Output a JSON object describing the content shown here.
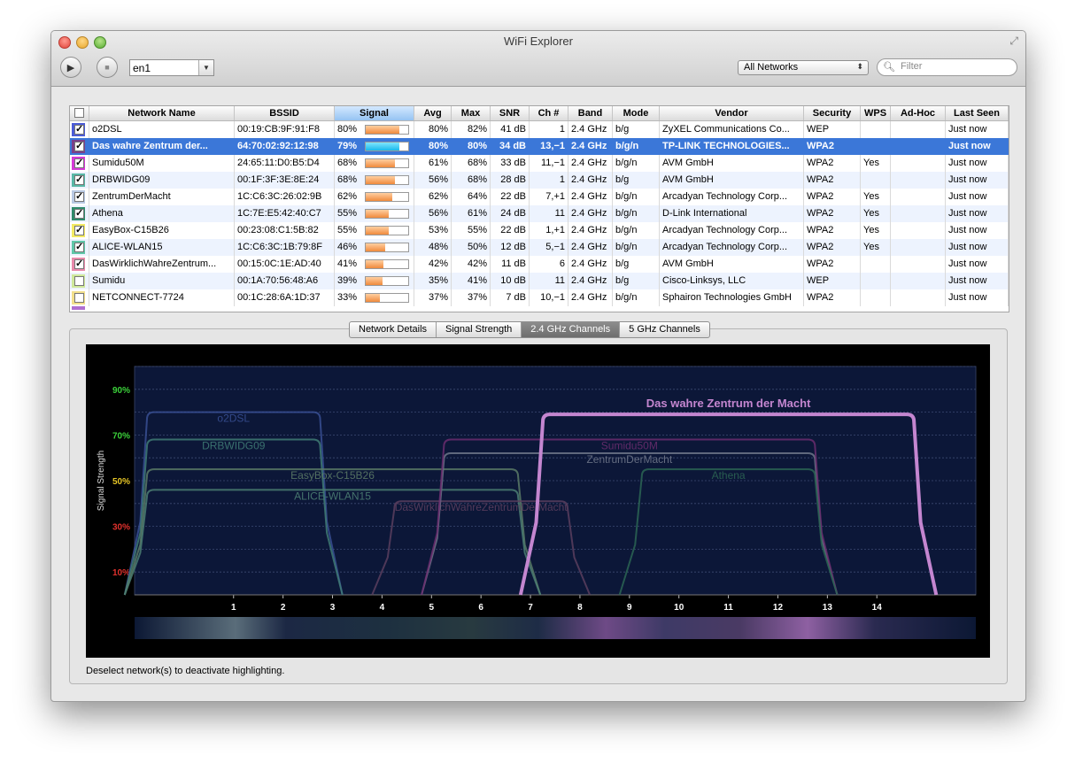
{
  "window": {
    "title": "WiFi Explorer"
  },
  "toolbar": {
    "interface_value": "en1",
    "networks_select": "All Networks",
    "filter_placeholder": "Filter"
  },
  "table": {
    "columns": [
      "Network Name",
      "BSSID",
      "Signal",
      "Avg",
      "Max",
      "SNR",
      "Ch #",
      "Band",
      "Mode",
      "Vendor",
      "Security",
      "WPS",
      "Ad-Hoc",
      "Last Seen"
    ],
    "rows": [
      {
        "name": "o2DSL",
        "bssid": "00:19:CB:9F:91:F8",
        "signal": "80%",
        "signal_value": 80,
        "avg": "80%",
        "max": "82%",
        "snr": "41 dB",
        "ch": "1",
        "band": "2.4 GHz",
        "mode": "b/g",
        "vendor": "ZyXEL Communications Co...",
        "security": "WEP",
        "wps": "",
        "adhoc": "",
        "last_seen": "Just now",
        "color": "#4b5bd6",
        "checked": true
      },
      {
        "name": "Das wahre Zentrum der...",
        "bssid": "64:70:02:92:12:98",
        "signal": "79%",
        "signal_value": 79,
        "avg": "80%",
        "max": "80%",
        "snr": "34 dB",
        "ch": "13,−1",
        "band": "2.4 GHz",
        "mode": "b/g/n",
        "vendor": "TP-LINK TECHNOLOGIES...",
        "security": "WPA2",
        "wps": "",
        "adhoc": "",
        "last_seen": "Just now",
        "color": "#7a3f8a",
        "checked": true
      },
      {
        "name": "Sumidu50M",
        "bssid": "24:65:11:D0:B5:D4",
        "signal": "68%",
        "signal_value": 68,
        "avg": "61%",
        "max": "68%",
        "snr": "33 dB",
        "ch": "11,−1",
        "band": "2.4 GHz",
        "mode": "b/g/n",
        "vendor": "AVM GmbH",
        "security": "WPA2",
        "wps": "Yes",
        "adhoc": "",
        "last_seen": "Just now",
        "color": "#d63ad8",
        "checked": true
      },
      {
        "name": "DRBWIDG09",
        "bssid": "00:1F:3F:3E:8E:24",
        "signal": "68%",
        "signal_value": 68,
        "avg": "56%",
        "max": "68%",
        "snr": "28 dB",
        "ch": "1",
        "band": "2.4 GHz",
        "mode": "b/g",
        "vendor": "AVM GmbH",
        "security": "WPA2",
        "wps": "",
        "adhoc": "",
        "last_seen": "Just now",
        "color": "#58b7a6",
        "checked": true
      },
      {
        "name": "ZentrumDerMacht",
        "bssid": "1C:C6:3C:26:02:9B",
        "signal": "62%",
        "signal_value": 62,
        "avg": "62%",
        "max": "64%",
        "snr": "22 dB",
        "ch": "7,+1",
        "band": "2.4 GHz",
        "mode": "b/g/n",
        "vendor": "Arcadyan Technology Corp...",
        "security": "WPA2",
        "wps": "Yes",
        "adhoc": "",
        "last_seen": "Just now",
        "color": "#b9c9e3",
        "checked": true
      },
      {
        "name": "Athena",
        "bssid": "1C:7E:E5:42:40:C7",
        "signal": "55%",
        "signal_value": 55,
        "avg": "56%",
        "max": "61%",
        "snr": "24 dB",
        "ch": "11",
        "band": "2.4 GHz",
        "mode": "b/g/n",
        "vendor": "D-Link International",
        "security": "WPA2",
        "wps": "Yes",
        "adhoc": "",
        "last_seen": "Just now",
        "color": "#2f8a6a",
        "checked": true
      },
      {
        "name": "EasyBox-C15B26",
        "bssid": "00:23:08:C1:5B:82",
        "signal": "55%",
        "signal_value": 55,
        "avg": "53%",
        "max": "55%",
        "snr": "22 dB",
        "ch": "1,+1",
        "band": "2.4 GHz",
        "mode": "b/g/n",
        "vendor": "Arcadyan Technology Corp...",
        "security": "WPA2",
        "wps": "Yes",
        "adhoc": "",
        "last_seen": "Just now",
        "color": "#f3ea63",
        "checked": true
      },
      {
        "name": "ALICE-WLAN15",
        "bssid": "1C:C6:3C:1B:79:8F",
        "signal": "46%",
        "signal_value": 46,
        "avg": "48%",
        "max": "50%",
        "snr": "12 dB",
        "ch": "5,−1",
        "band": "2.4 GHz",
        "mode": "b/g/n",
        "vendor": "Arcadyan Technology Corp...",
        "security": "WPA2",
        "wps": "Yes",
        "adhoc": "",
        "last_seen": "Just now",
        "color": "#5fc7a8",
        "checked": true
      },
      {
        "name": "DasWirklichWahreZentrum...",
        "bssid": "00:15:0C:1E:AD:40",
        "signal": "41%",
        "signal_value": 41,
        "avg": "42%",
        "max": "42%",
        "snr": "11 dB",
        "ch": "6",
        "band": "2.4 GHz",
        "mode": "b/g",
        "vendor": "AVM GmbH",
        "security": "WPA2",
        "wps": "",
        "adhoc": "",
        "last_seen": "Just now",
        "color": "#e88aab",
        "checked": true
      },
      {
        "name": "Sumidu",
        "bssid": "00:1A:70:56:48:A6",
        "signal": "39%",
        "signal_value": 39,
        "avg": "35%",
        "max": "41%",
        "snr": "10 dB",
        "ch": "11",
        "band": "2.4 GHz",
        "mode": "b/g",
        "vendor": "Cisco-Linksys, LLC",
        "security": "WEP",
        "wps": "",
        "adhoc": "",
        "last_seen": "Just now",
        "color": "#cfe89a",
        "checked": false
      },
      {
        "name": "NETCONNECT-7724",
        "bssid": "00:1C:28:6A:1D:37",
        "signal": "33%",
        "signal_value": 33,
        "avg": "37%",
        "max": "37%",
        "snr": "7 dB",
        "ch": "10,−1",
        "band": "2.4 GHz",
        "mode": "b/g/n",
        "vendor": "Sphairon Technologies GmbH",
        "security": "WPA2",
        "wps": "",
        "adhoc": "",
        "last_seen": "Just now",
        "color": "#f2e08c",
        "checked": false
      }
    ]
  },
  "tabs": [
    "Network Details",
    "Signal Strength",
    "2.4 GHz Channels",
    "5 GHz Channels"
  ],
  "active_tab": "2.4 GHz Channels",
  "chart_data": {
    "type": "area",
    "ylabel": "Signal Strength",
    "y_ticks": [
      "10%",
      "30%",
      "50%",
      "70%",
      "90%"
    ],
    "y_tick_values": [
      10,
      30,
      50,
      70,
      90
    ],
    "x_ticks": [
      "1",
      "2",
      "3",
      "4",
      "5",
      "6",
      "7",
      "8",
      "9",
      "10",
      "11",
      "12",
      "13",
      "14"
    ],
    "xlim": [
      -1,
      16
    ],
    "ylim": [
      0,
      100
    ],
    "highlight_title": "Das wahre Zentrum der Macht",
    "series": [
      {
        "name": "o2DSL",
        "channels": [
          1
        ],
        "width": 22,
        "signal": 80,
        "color": "#384f93"
      },
      {
        "name": "DRBWIDG09",
        "channels": [
          1
        ],
        "width": 22,
        "signal": 68,
        "color": "#3f7b74"
      },
      {
        "name": "EasyBox-C15B26",
        "channels": [
          1,
          5
        ],
        "width": 40,
        "signal": 55,
        "color": "#5b7a66"
      },
      {
        "name": "ALICE-WLAN15",
        "channels": [
          1,
          5
        ],
        "width": 40,
        "signal": 46,
        "color": "#4b7e72"
      },
      {
        "name": "DasWirklichWahreZentrumDerMacht",
        "channels": [
          6
        ],
        "width": 22,
        "signal": 41,
        "color": "#5b3e5e"
      },
      {
        "name": "ZentrumDerMacht",
        "channels": [
          7,
          11
        ],
        "width": 40,
        "signal": 62,
        "color": "#6f778a"
      },
      {
        "name": "Sumidu50M",
        "channels": [
          7,
          11
        ],
        "width": 40,
        "signal": 68,
        "color": "#6b2d6e"
      },
      {
        "name": "Athena",
        "channels": [
          11
        ],
        "width": 22,
        "signal": 55,
        "color": "#2c6553"
      },
      {
        "name": "Das wahre Zentrum der Macht",
        "channels": [
          9,
          13
        ],
        "width": 40,
        "signal": 79,
        "color": "#c486d0",
        "highlight": true
      }
    ]
  },
  "status": "Deselect network(s) to deactivate highlighting."
}
